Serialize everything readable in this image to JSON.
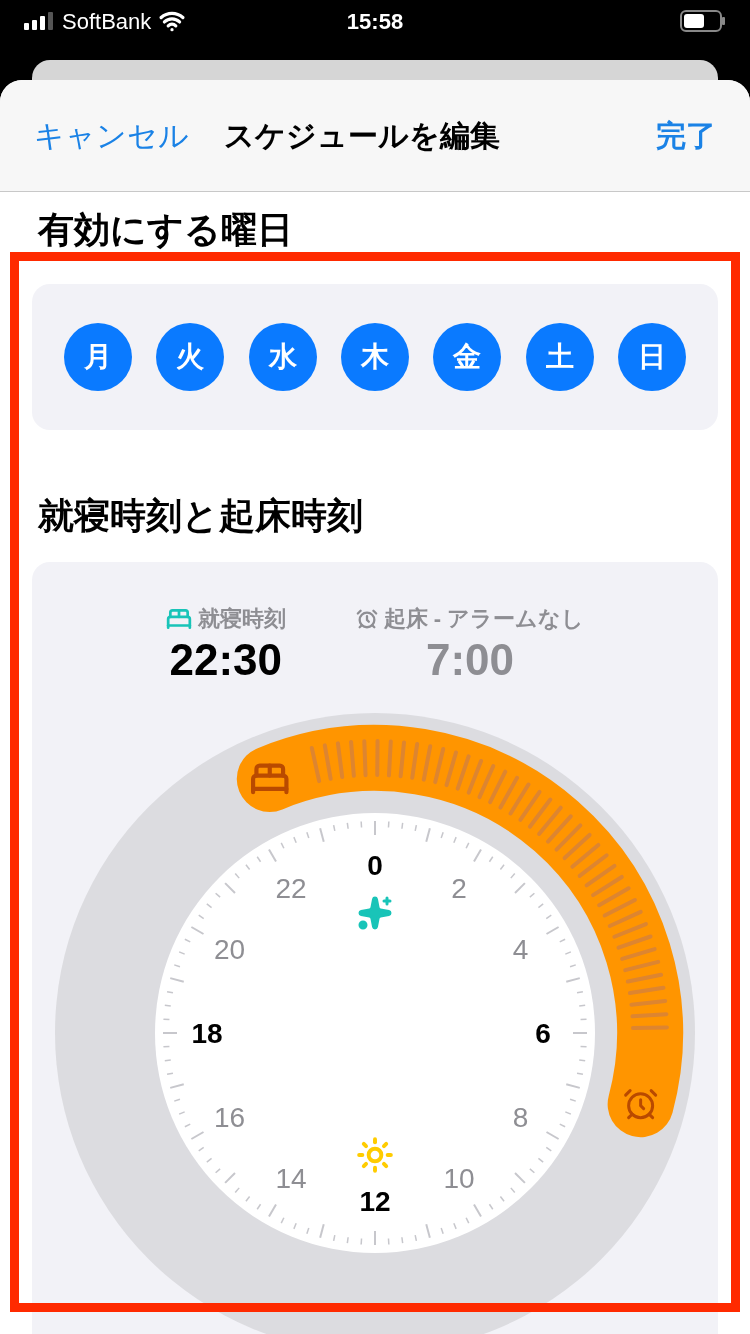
{
  "status_bar": {
    "carrier": "SoftBank",
    "time": "15:58"
  },
  "nav": {
    "cancel": "キャンセル",
    "title": "スケジュールを編集",
    "done": "完了"
  },
  "days_section": {
    "title": "有効にする曜日",
    "days": [
      {
        "label": "月",
        "selected": true
      },
      {
        "label": "火",
        "selected": true
      },
      {
        "label": "水",
        "selected": true
      },
      {
        "label": "木",
        "selected": true
      },
      {
        "label": "金",
        "selected": true
      },
      {
        "label": "土",
        "selected": true
      },
      {
        "label": "日",
        "selected": true
      }
    ]
  },
  "sleep_section": {
    "title": "就寝時刻と起床時刻",
    "bedtime": {
      "label": "就寝時刻",
      "time": "22:30"
    },
    "wake": {
      "label": "起床 - アラームなし",
      "time": "7:00",
      "alarm_on": false
    },
    "clock_labels": [
      {
        "text": "0",
        "kind": "major"
      },
      {
        "text": "2",
        "kind": "minor"
      },
      {
        "text": "4",
        "kind": "minor"
      },
      {
        "text": "6",
        "kind": "major"
      },
      {
        "text": "8",
        "kind": "minor"
      },
      {
        "text": "10",
        "kind": "minor"
      },
      {
        "text": "12",
        "kind": "major"
      },
      {
        "text": "14",
        "kind": "minor"
      },
      {
        "text": "16",
        "kind": "minor"
      },
      {
        "text": "18",
        "kind": "major"
      },
      {
        "text": "20",
        "kind": "minor"
      },
      {
        "text": "22",
        "kind": "minor"
      }
    ]
  }
}
